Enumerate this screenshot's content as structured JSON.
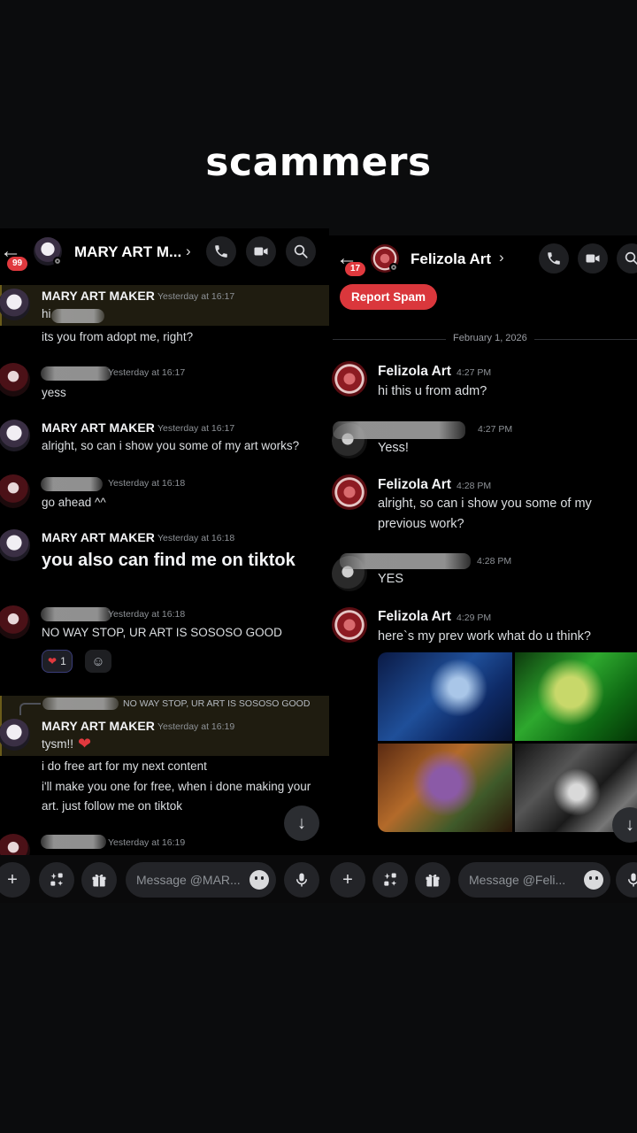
{
  "caption": "scammers",
  "left": {
    "badge": "99",
    "title": "MARY ART M...",
    "messages": [
      {
        "user": "MARY ART MAKER",
        "time": "Yesterday at 16:17",
        "line1": "hi",
        "line2": "its you from adopt me, right?"
      },
      {
        "time": "Yesterday at 16:17",
        "line1": "yess"
      },
      {
        "user": "MARY ART MAKER",
        "time": "Yesterday at 16:17",
        "line1": "alright, so can i show you some of my art works?"
      },
      {
        "time": "Yesterday at 16:18",
        "line1": "go ahead ^^"
      },
      {
        "user": "MARY ART MAKER",
        "time": "Yesterday at 16:18",
        "line1": "you also can find me on tiktok"
      },
      {
        "time": "Yesterday at 16:18",
        "line1": "NO WAY STOP, UR ART IS SOSOSO GOOD",
        "reaction_count": "1"
      },
      {
        "reply": "NO WAY STOP, UR ART IS SOSOSO GOOD",
        "user": "MARY ART MAKER",
        "time": "Yesterday at 16:19",
        "line1": "tysm!!",
        "line2": "i do free art for my next content",
        "line3": "i'll make you one for free, when i done making your",
        "line4": "art. just follow me on tiktok"
      },
      {
        "time": "Yesterday at 16:19"
      }
    ],
    "input_placeholder": "Message @MAR..."
  },
  "right": {
    "badge": "17",
    "title": "Felizola Art",
    "report_label": "Report Spam",
    "date_divider": "February 1, 2026",
    "messages": [
      {
        "user": "Felizola Art",
        "time": "4:27 PM",
        "line1": "hi this u from adm?"
      },
      {
        "time": "4:27 PM",
        "line1": "Yess!"
      },
      {
        "user": "Felizola Art",
        "time": "4:28 PM",
        "line1": "alright, so can i show you some of my",
        "line2": "previous work?"
      },
      {
        "time": "4:28 PM",
        "line1": "YES"
      },
      {
        "user": "Felizola Art",
        "time": "4:29 PM",
        "line1": "here`s my prev work what do u think?"
      }
    ],
    "input_placeholder": "Message @Feli..."
  },
  "icons": [
    "back-arrow-icon",
    "phone-icon",
    "video-icon",
    "search-icon",
    "chevron-right-icon",
    "plus-icon",
    "apps-icon",
    "gift-icon",
    "emoji-icon",
    "microphone-icon",
    "arrow-down-icon",
    "heart-icon"
  ],
  "colors": {
    "background": "#000000",
    "danger": "#da373c",
    "badge": "#e0393e"
  }
}
